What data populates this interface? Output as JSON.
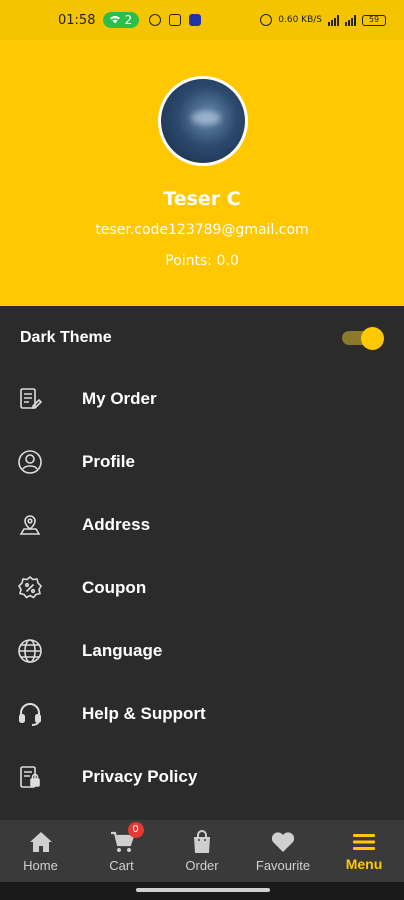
{
  "status_bar": {
    "time": "01:58",
    "wifi_count": "2",
    "net_speed": "0.60 KB/S",
    "battery": "59"
  },
  "profile": {
    "name": "Teser C",
    "email": "teser.code123789@gmail.com",
    "points": "Points: 0.0"
  },
  "theme": {
    "label": "Dark Theme",
    "enabled": true,
    "accent_color": "#ffc800"
  },
  "menu_items": [
    {
      "label": "My Order",
      "icon": "order-list-icon"
    },
    {
      "label": "Profile",
      "icon": "user-circle-icon"
    },
    {
      "label": "Address",
      "icon": "location-icon"
    },
    {
      "label": "Coupon",
      "icon": "coupon-percent-icon"
    },
    {
      "label": "Language",
      "icon": "globe-icon"
    },
    {
      "label": "Help & Support",
      "icon": "headset-icon"
    },
    {
      "label": "Privacy Policy",
      "icon": "document-lock-icon"
    }
  ],
  "bottom_nav": {
    "items": [
      {
        "label": "Home",
        "icon": "home-icon"
      },
      {
        "label": "Cart",
        "icon": "cart-icon",
        "badge": "0"
      },
      {
        "label": "Order",
        "icon": "shopping-bag-icon"
      },
      {
        "label": "Favourite",
        "icon": "heart-icon"
      },
      {
        "label": "Menu",
        "icon": "hamburger-menu-icon",
        "active": true
      }
    ]
  },
  "colors": {
    "header_bg": "#ffc800",
    "menu_bg": "#2b2b2b",
    "nav_bg": "#3a3a3a",
    "badge": "#e53935"
  }
}
